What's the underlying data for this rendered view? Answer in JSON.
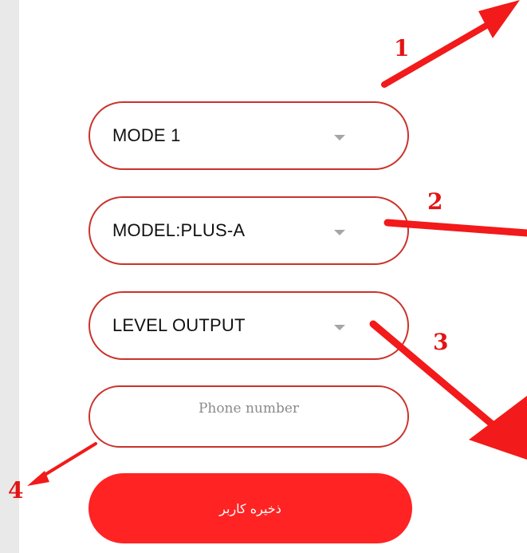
{
  "dropdowns": [
    {
      "label": "MODE 1"
    },
    {
      "label": "MODEL:PLUS-A"
    },
    {
      "label": "LEVEL OUTPUT"
    }
  ],
  "phone": {
    "placeholder": "Phone number",
    "value": ""
  },
  "save_button": {
    "label": "ذخیره کاربر"
  },
  "annotations": [
    "1",
    "2",
    "3",
    "4"
  ],
  "colors": {
    "field_border": "#c9332b",
    "button_bg": "#ff2323",
    "annotation_red": "#e31414",
    "caret": "#a6a6a6",
    "side_strip": "#e9e9e9"
  },
  "icons": [
    "chevron-down-icon",
    "arrow-icon"
  ]
}
